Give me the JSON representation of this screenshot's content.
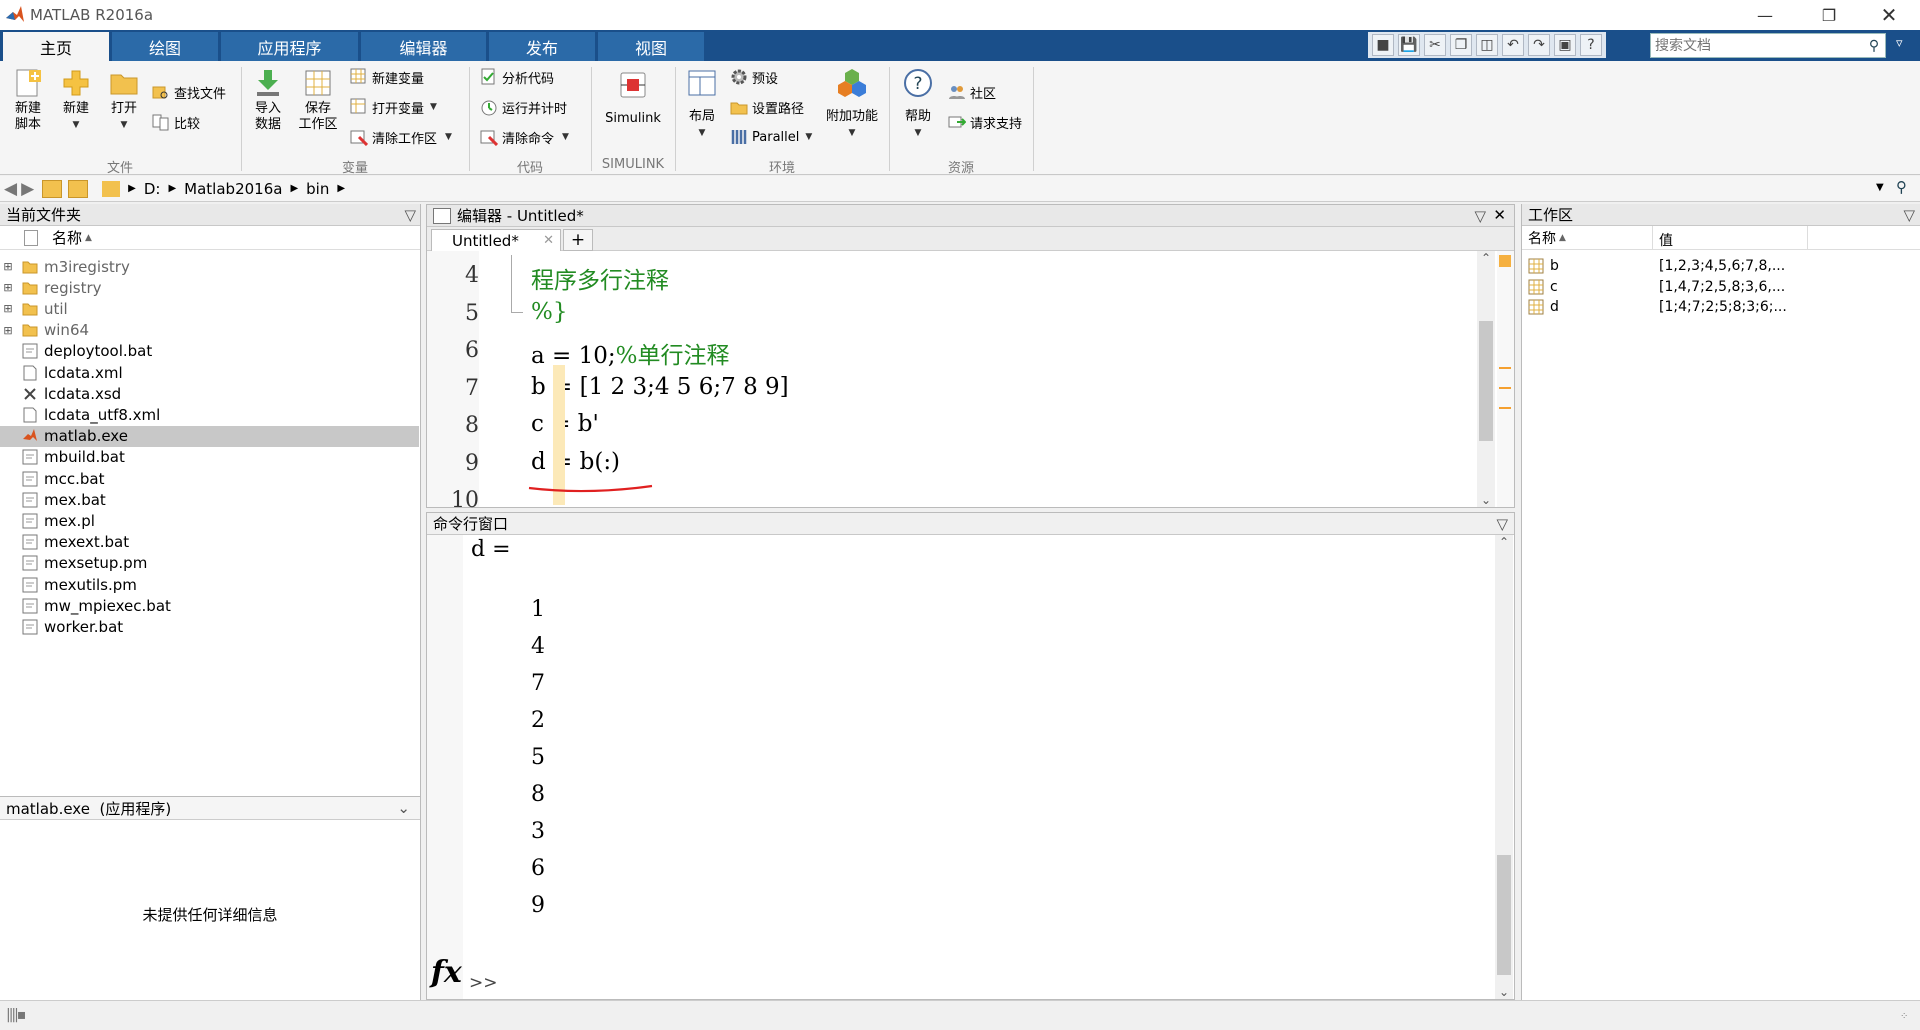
{
  "window": {
    "title": "MATLAB R2016a"
  },
  "ribbon_tabs": [
    "主页",
    "绘图",
    "应用程序",
    "编辑器",
    "发布",
    "视图"
  ],
  "search": {
    "placeholder": "搜索文档"
  },
  "ribbon": {
    "file": {
      "new_script": "新建\n脚本",
      "new": "新建",
      "open": "打开",
      "find_files": "查找文件",
      "compare": "比较",
      "group": "文件"
    },
    "variable": {
      "import": "导入\n数据",
      "save_ws": "保存\n工作区",
      "new_var": "新建变量",
      "open_var": "打开变量",
      "clear_ws": "清除工作区",
      "group": "变量"
    },
    "code": {
      "analyze": "分析代码",
      "run_time": "运行并计时",
      "clear_cmd": "清除命令",
      "group": "代码"
    },
    "simulink": {
      "label": "Simulink",
      "group": "SIMULINK"
    },
    "env": {
      "layout": "布局",
      "prefs": "预设",
      "set_path": "设置路径",
      "parallel": "Parallel",
      "addons": "附加功能",
      "group": "环境"
    },
    "resources": {
      "help": "帮助",
      "community": "社区",
      "support": "请求支持",
      "group": "资源"
    }
  },
  "address": {
    "parts": [
      "D:",
      "Matlab2016a",
      "bin"
    ]
  },
  "current_folder": {
    "title": "当前文件夹",
    "col_name": "名称",
    "items": [
      {
        "name": "m3iregistry",
        "type": "folder"
      },
      {
        "name": "registry",
        "type": "folder"
      },
      {
        "name": "util",
        "type": "folder"
      },
      {
        "name": "win64",
        "type": "folder"
      },
      {
        "name": "deploytool.bat",
        "type": "bat"
      },
      {
        "name": "lcdata.xml",
        "type": "xml"
      },
      {
        "name": "lcdata.xsd",
        "type": "xsd"
      },
      {
        "name": "lcdata_utf8.xml",
        "type": "xml"
      },
      {
        "name": "matlab.exe",
        "type": "exe",
        "selected": true
      },
      {
        "name": "mbuild.bat",
        "type": "bat"
      },
      {
        "name": "mcc.bat",
        "type": "bat"
      },
      {
        "name": "mex.bat",
        "type": "bat"
      },
      {
        "name": "mex.pl",
        "type": "bat"
      },
      {
        "name": "mexext.bat",
        "type": "bat"
      },
      {
        "name": "mexsetup.pm",
        "type": "bat"
      },
      {
        "name": "mexutils.pm",
        "type": "bat"
      },
      {
        "name": "mw_mpiexec.bat",
        "type": "bat"
      },
      {
        "name": "worker.bat",
        "type": "bat"
      }
    ],
    "details_title": "matlab.exe  (应用程序)",
    "details_empty": "未提供任何详细信息"
  },
  "editor": {
    "title": "编辑器 - Untitled*",
    "tab": "Untitled*",
    "lines": [
      {
        "num": "4",
        "text": "程序多行注释",
        "cls": "cmt"
      },
      {
        "num": "5",
        "text": "%}",
        "cls": "cmt"
      },
      {
        "num": "6",
        "text": "a = 10;",
        "tail": "%单行注释"
      },
      {
        "num": "7",
        "text": "b = [1 2 3;4 5 6;7 8 9]"
      },
      {
        "num": "8",
        "text": "c = b'"
      },
      {
        "num": "9",
        "text": "d = b(:)"
      },
      {
        "num": "10",
        "text": ""
      }
    ]
  },
  "command": {
    "title": "命令行窗口",
    "var": "d =",
    "values": [
      "1",
      "4",
      "7",
      "2",
      "5",
      "8",
      "3",
      "6",
      "9"
    ],
    "prompt": ">>",
    "fx": "fx"
  },
  "workspace": {
    "title": "工作区",
    "col_name": "名称",
    "col_value": "值",
    "vars": [
      {
        "name": "b",
        "value": "[1,2,3;4,5,6;7,8,..."
      },
      {
        "name": "c",
        "value": "[1,4,7;2,5,8;3,6,..."
      },
      {
        "name": "d",
        "value": "[1;4;7;2;5;8;3;6;..."
      }
    ]
  },
  "colors": {
    "tab_bar": "#1a4f8a",
    "comment": "#228b22",
    "selection": "#c8c8c8"
  }
}
